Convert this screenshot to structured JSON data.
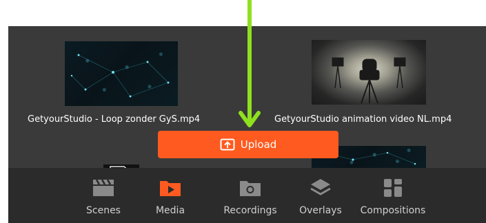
{
  "media": {
    "items": [
      {
        "filename": "GetyourStudio - Loop zonder GyS.mp4"
      },
      {
        "filename": "GetyourStudio animation video NL.mp4"
      }
    ]
  },
  "upload": {
    "label": "Upload"
  },
  "nav": {
    "items": [
      {
        "label": "Scenes",
        "icon": "clapperboard-icon"
      },
      {
        "label": "Media",
        "icon": "media-folder-icon",
        "active": true
      },
      {
        "label": "Recordings",
        "icon": "recordings-folder-icon"
      },
      {
        "label": "Overlays",
        "icon": "layers-icon"
      },
      {
        "label": "Compositions",
        "icon": "grid-icon"
      }
    ]
  },
  "colors": {
    "accent": "#ff5a1f",
    "arrow": "#8fe01f",
    "panel": "#3a3a3a",
    "bottom_bar": "#2b2b2b"
  }
}
